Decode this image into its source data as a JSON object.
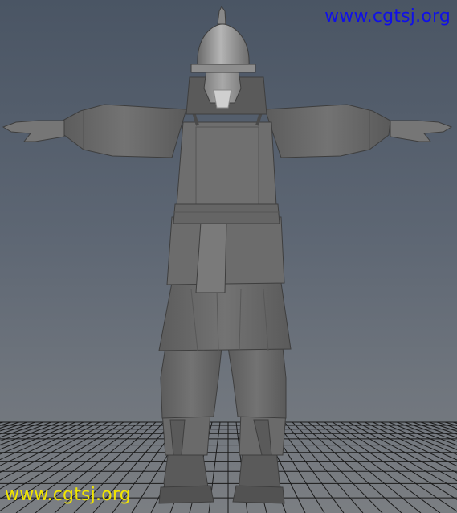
{
  "viewport": {
    "background_top": "#4a5564",
    "background_bottom": "#7b7e82",
    "grid_color": "#1a1a1a",
    "model_color": "#6b6b6b"
  },
  "watermarks": {
    "top_right": {
      "text": "www.cgtsj.org",
      "color": "#1010e8"
    },
    "bottom_left": {
      "text": "www.cgtsj.org",
      "color": "#f2e600"
    }
  },
  "model": {
    "subject": "armored soldier in T-pose",
    "parts": [
      "helmet",
      "head",
      "beard",
      "torso-vest",
      "belt",
      "tunic-skirt",
      "left-arm",
      "right-arm",
      "left-leg",
      "right-leg",
      "boots"
    ]
  }
}
